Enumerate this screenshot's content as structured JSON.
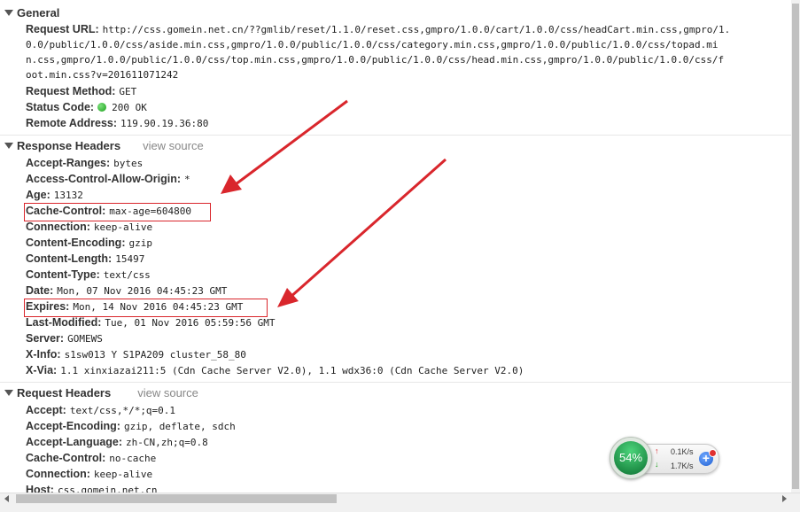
{
  "general": {
    "title": "General",
    "request_url_label": "Request URL:",
    "request_url_lines": [
      "http://css.gomein.net.cn/??gmlib/reset/1.1.0/reset.css,gmpro/1.0.0/cart/1.0.0/css/headCart.min.css,gmpro/1.",
      "0.0/public/1.0.0/css/aside.min.css,gmpro/1.0.0/public/1.0.0/css/category.min.css,gmpro/1.0.0/public/1.0.0/css/topad.mi",
      "n.css,gmpro/1.0.0/public/1.0.0/css/top.min.css,gmpro/1.0.0/public/1.0.0/css/head.min.css,gmpro/1.0.0/public/1.0.0/css/f",
      "oot.min.css?v=201611071242"
    ],
    "method_label": "Request Method:",
    "method_value": "GET",
    "status_label": "Status Code:",
    "status_value": "200 OK",
    "remote_label": "Remote Address:",
    "remote_value": "119.90.19.36:80"
  },
  "response_headers": {
    "title": "Response Headers",
    "view_source": "view source",
    "items": [
      {
        "key": "Accept-Ranges:",
        "value": "bytes"
      },
      {
        "key": "Access-Control-Allow-Origin:",
        "value": "*"
      },
      {
        "key": "Age:",
        "value": "13132"
      },
      {
        "key": "Cache-Control:",
        "value": "max-age=604800"
      },
      {
        "key": "Connection:",
        "value": "keep-alive"
      },
      {
        "key": "Content-Encoding:",
        "value": "gzip"
      },
      {
        "key": "Content-Length:",
        "value": "15497"
      },
      {
        "key": "Content-Type:",
        "value": "text/css"
      },
      {
        "key": "Date:",
        "value": "Mon, 07 Nov 2016 04:45:23 GMT"
      },
      {
        "key": "Expires:",
        "value": "Mon, 14 Nov 2016 04:45:23 GMT"
      },
      {
        "key": "Last-Modified:",
        "value": "Tue, 01 Nov 2016 05:59:56 GMT"
      },
      {
        "key": "Server:",
        "value": "GOMEWS"
      },
      {
        "key": "X-Info:",
        "value": "s1sw013 Y S1PA209 cluster_58_80"
      },
      {
        "key": "X-Via:",
        "value": "1.1 xinxiazai211:5 (Cdn Cache Server V2.0), 1.1 wdx36:0 (Cdn Cache Server V2.0)"
      }
    ]
  },
  "request_headers": {
    "title": "Request Headers",
    "view_source": "view source",
    "items": [
      {
        "key": "Accept:",
        "value": "text/css,*/*;q=0.1"
      },
      {
        "key": "Accept-Encoding:",
        "value": "gzip, deflate, sdch"
      },
      {
        "key": "Accept-Language:",
        "value": "zh-CN,zh;q=0.8"
      },
      {
        "key": "Cache-Control:",
        "value": "no-cache"
      },
      {
        "key": "Connection:",
        "value": "keep-alive"
      },
      {
        "key": "Host:",
        "value": "css.gomein.net.cn"
      }
    ]
  },
  "speed_widget": {
    "percent": "54%",
    "upload": "0.1K/s",
    "download": "1.7K/s",
    "plus": "+"
  },
  "colors": {
    "annotation_red": "#d9262c",
    "status_green": "#1aa01a"
  }
}
